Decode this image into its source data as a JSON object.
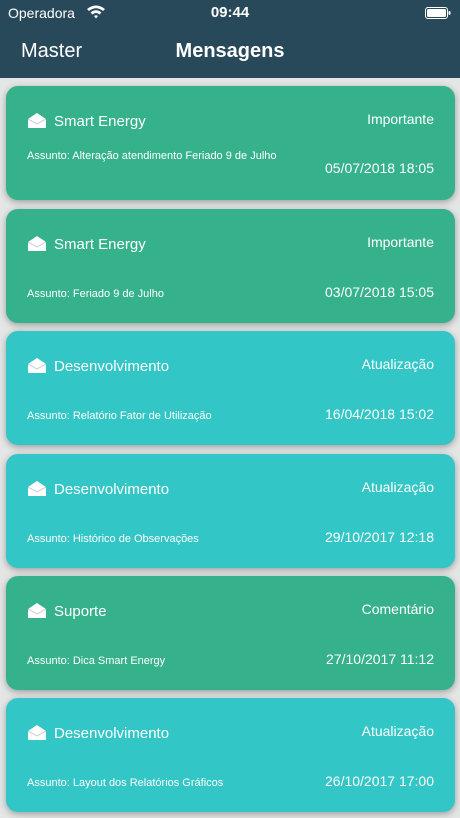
{
  "status_bar": {
    "carrier": "Operadora",
    "time": "09:44"
  },
  "nav": {
    "back_label": "Master",
    "title": "Mensagens",
    "bar_color": "#27495a"
  },
  "colors": {
    "green_card": "#35b18b",
    "teal_card": "#33c6c6",
    "background": "#e4e6e6"
  },
  "messages": [
    {
      "sender": "Smart Energy",
      "category": "Importante",
      "subject": "Assunto: Alteração atendimento Feriado 9 de Julho",
      "date": "05/07/2018 18:05",
      "color": "#35b18b"
    },
    {
      "sender": "Smart Energy",
      "category": "Importante",
      "subject": "Assunto: Feriado 9 de Julho",
      "date": "03/07/2018 15:05",
      "color": "#35b18b"
    },
    {
      "sender": "Desenvolvimento",
      "category": "Atualização",
      "subject": "Assunto: Relatório Fator de Utilização",
      "date": "16/04/2018 15:02",
      "color": "#33c6c6"
    },
    {
      "sender": "Desenvolvimento",
      "category": "Atualização",
      "subject": "Assunto: Histórico de Observações",
      "date": "29/10/2017 12:18",
      "color": "#33c6c6"
    },
    {
      "sender": "Suporte",
      "category": "Comentário",
      "subject": "Assunto: Dica Smart Energy",
      "date": "27/10/2017 11:12",
      "color": "#35b18b"
    },
    {
      "sender": "Desenvolvimento",
      "category": "Atualização",
      "subject": "Assunto: Layout dos Relatórios Gráficos",
      "date": "26/10/2017 17:00",
      "color": "#33c6c6"
    }
  ]
}
